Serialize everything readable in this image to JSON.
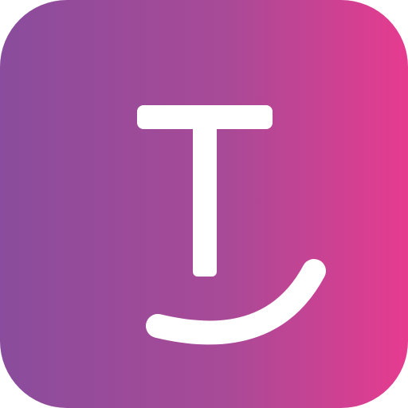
{
  "logo": {
    "name": "smiling-t-logo",
    "colors": {
      "gradient_start": "#8a4c9c",
      "gradient_mid": "#a84a97",
      "gradient_end": "#e63b8f",
      "mark": "#ffffff"
    }
  }
}
